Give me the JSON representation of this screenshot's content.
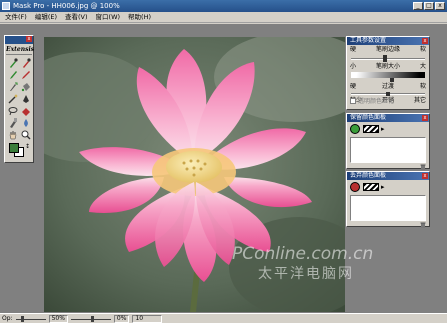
{
  "window": {
    "title": "Mask Pro - HH006.jpg @ 100%",
    "controls": {
      "minimize": "_",
      "maximize": "□",
      "close": "x"
    }
  },
  "menu": [
    "文件(F)",
    "编辑(E)",
    "查看(V)",
    "窗口(W)",
    "帮助(H)"
  ],
  "toolbox": {
    "brand": "Extensis",
    "tools": [
      "eyedropper-keep-icon",
      "eyedropper-drop-icon",
      "brush-icon",
      "pencil-icon",
      "magic-brush-icon",
      "bucket-icon",
      "magic-wand-icon",
      "pen-icon",
      "lasso-icon",
      "eraser-icon",
      "chisel-icon",
      "blur-icon",
      "hand-icon",
      "zoom-icon"
    ],
    "swap_glyph": "↕"
  },
  "tool_options": {
    "title": "工具参数设置",
    "row1": {
      "left": "硬",
      "center": "笔刷边缘",
      "right": "软"
    },
    "row2": {
      "left": "小",
      "center": "笔刷大小",
      "right": "大"
    },
    "row3": {
      "left": "硬",
      "center": "过渡",
      "right": "软"
    },
    "row4": {
      "left": "较少",
      "center": "开销",
      "right": "其它"
    },
    "checkbox_label": "透明颜色继化",
    "sliders": {
      "edge": 0.45,
      "size": 0.55,
      "blend": 0.5,
      "cost": 0.05
    }
  },
  "keep_panel": {
    "title": "保留颜色面板",
    "arrow": "▸"
  },
  "drop_panel": {
    "title": "丢弃颜色面板",
    "arrow": "▸"
  },
  "status": {
    "opacity_label": "Op:",
    "opacity_value": 0.2,
    "zoom": "50%",
    "value_box": "0%",
    "misc": "10",
    "zoom_slider": 0.55
  },
  "watermark": {
    "brand": "PConline.com.cn",
    "chinese": "太平洋电脑网"
  },
  "colors": {
    "title_bar": "#25508a",
    "petal_pink": "#e8589a",
    "flower_center": "#f2d98a",
    "keep_swatch": "#3a9d3a",
    "drop_swatch": "#b83030"
  }
}
